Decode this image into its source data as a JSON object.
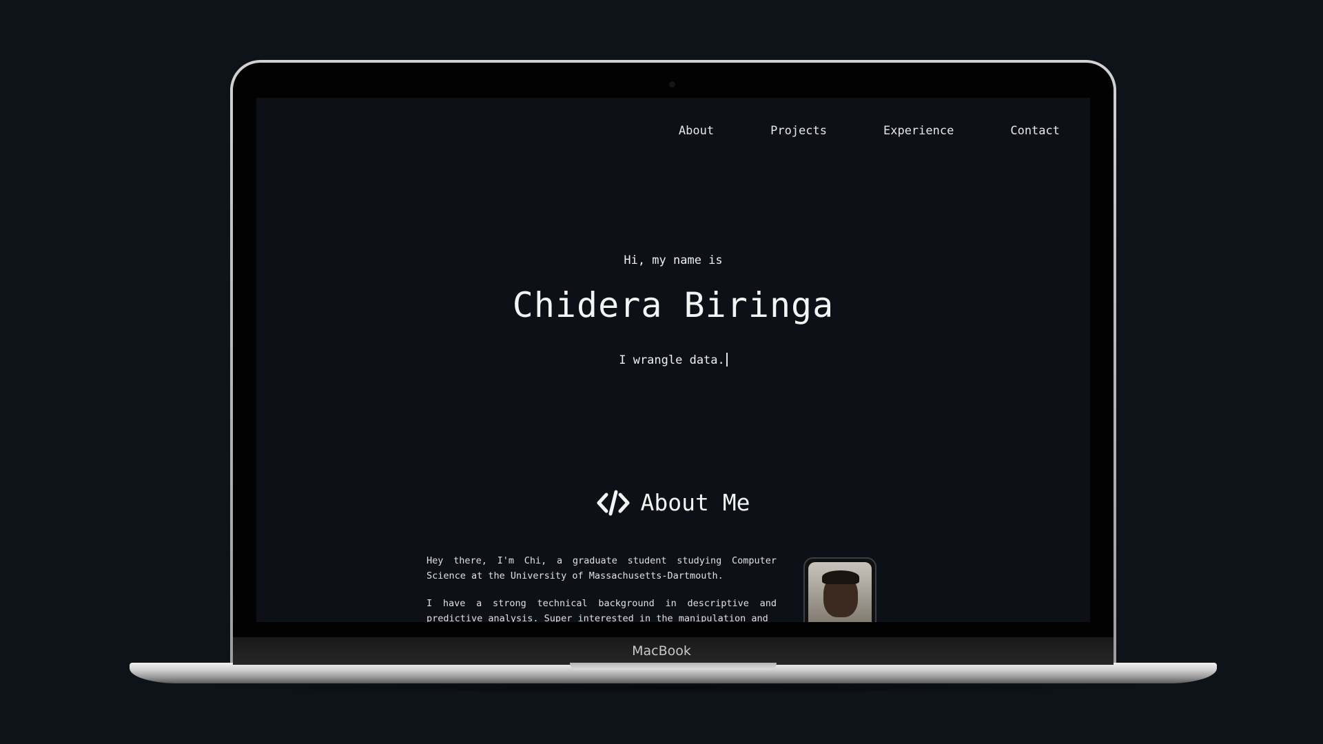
{
  "device": {
    "brand_label": "MacBook"
  },
  "nav": {
    "items": [
      {
        "label": "About"
      },
      {
        "label": "Projects"
      },
      {
        "label": "Experience"
      },
      {
        "label": "Contact"
      }
    ]
  },
  "hero": {
    "greeting": "Hi, my name is",
    "name": "Chidera Biringa",
    "tagline": "I wrangle data."
  },
  "about": {
    "icon": "code-icon",
    "title": "About Me",
    "paragraphs": [
      "Hey there, I'm Chi, a graduate student studying Computer Science at the University of Massachusetts-Dartmouth.",
      "I have a strong technical background in descriptive and predictive analysis. Super interested in the manipulation and"
    ],
    "photo": "profile-photo"
  },
  "colors": {
    "background": "#0e131a",
    "screen_background": "#0d1117",
    "text": "#e6e6e6"
  }
}
